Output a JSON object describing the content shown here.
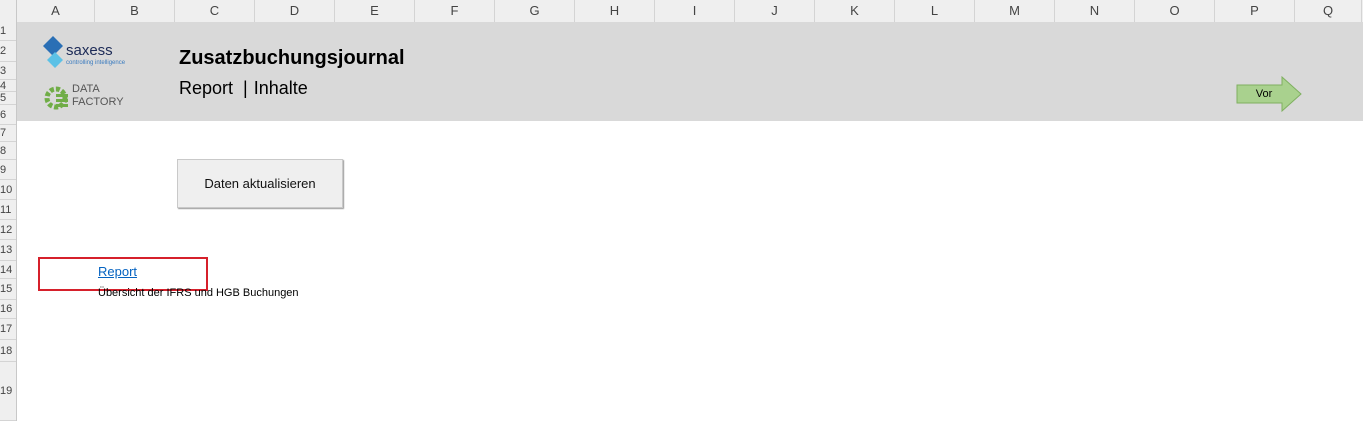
{
  "columns": [
    "A",
    "B",
    "C",
    "D",
    "E",
    "F",
    "G",
    "H",
    "I",
    "J",
    "K",
    "L",
    "M",
    "N",
    "O",
    "P",
    "Q"
  ],
  "rows": [
    "1",
    "2",
    "3",
    "4",
    "5",
    "6",
    "7",
    "8",
    "9",
    "10",
    "11",
    "12",
    "13",
    "14",
    "15",
    "16",
    "17",
    "18",
    "19"
  ],
  "header": {
    "logo_saxess": {
      "name": "saxess",
      "tagline": "controlling intelligence"
    },
    "logo_datafactory": {
      "line1": "DATA",
      "line2": "FACTORY"
    },
    "title": "Zusatzbuchungsjournal",
    "nav_report": "Report",
    "nav_sep": "|",
    "nav_inhalte": "Inhalte",
    "vor_label": "Vor"
  },
  "main": {
    "refresh_button": "Daten aktualisieren",
    "report_link": "Report",
    "report_description": "Übersicht der IFRS und HGB Buchungen"
  },
  "colors": {
    "banner": "#d9d9d9",
    "link": "#0563c1",
    "highlight": "#d6202b",
    "arrow": "#a9d18e",
    "saxess_blue": "#2a6fb5",
    "datafactory_green": "#70ad47"
  }
}
